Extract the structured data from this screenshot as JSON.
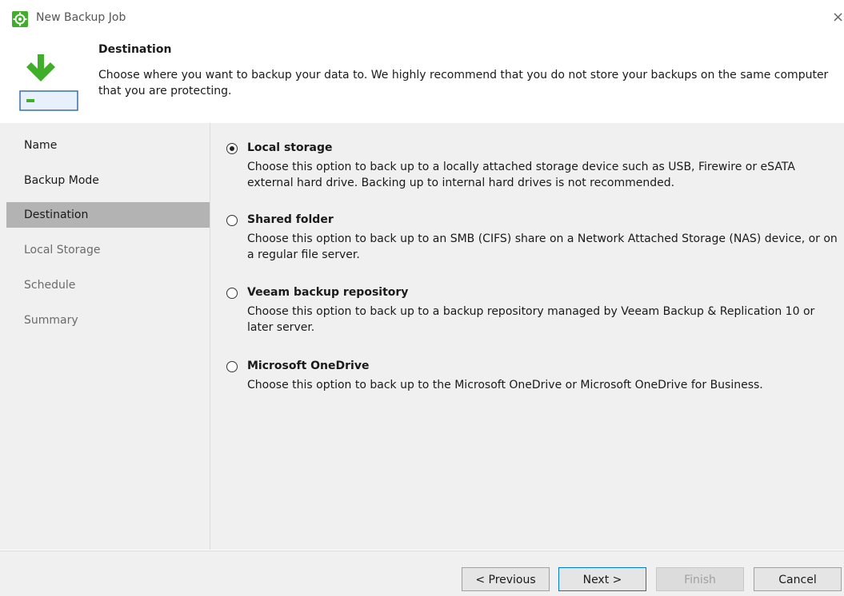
{
  "window": {
    "title": "New Backup Job",
    "icon": "veeam-gear-icon",
    "close_glyph": "×"
  },
  "header": {
    "title": "Destination",
    "description": "Choose where you want to backup your data to. We highly recommend that you do not store your backups on the same computer that you are protecting.",
    "icon": "backup-destination-icon"
  },
  "sidebar": {
    "items": [
      {
        "label": "Name",
        "state": "done"
      },
      {
        "label": "Backup Mode",
        "state": "done"
      },
      {
        "label": "Destination",
        "state": "active"
      },
      {
        "label": "Local Storage",
        "state": "future"
      },
      {
        "label": "Schedule",
        "state": "future"
      },
      {
        "label": "Summary",
        "state": "future"
      }
    ]
  },
  "options": [
    {
      "label": "Local storage",
      "description": "Choose this option to back up to a locally attached storage device such as USB, Firewire or eSATA external hard drive. Backing up to internal hard drives is not recommended.",
      "selected": true
    },
    {
      "label": "Shared folder",
      "description": "Choose this option to back up to an SMB (CIFS) share on a Network Attached Storage (NAS) device, or on a regular file server.",
      "selected": false
    },
    {
      "label": "Veeam backup repository",
      "description": "Choose this option to back up to a backup repository managed by Veeam Backup & Replication 10 or later server.",
      "selected": false
    },
    {
      "label": "Microsoft OneDrive",
      "description": "Choose this option to back up to the Microsoft OneDrive or Microsoft OneDrive for Business.",
      "selected": false
    }
  ],
  "buttons": {
    "previous": "< Previous",
    "next": "Next >",
    "finish": "Finish",
    "cancel": "Cancel"
  },
  "colors": {
    "accent_green": "#3fae29",
    "active_nav": "#b3b3b3",
    "primary_border": "#0078d7"
  }
}
